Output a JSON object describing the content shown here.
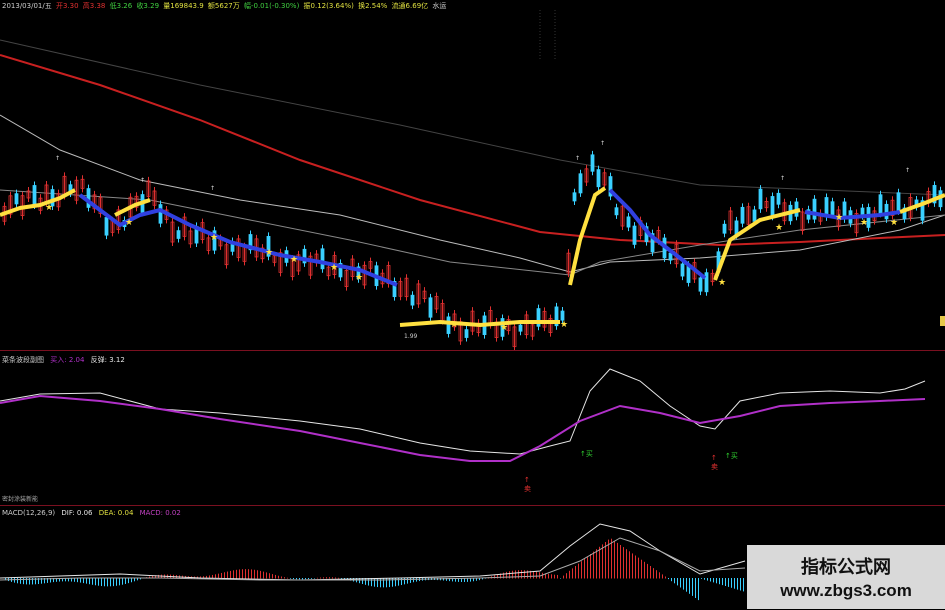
{
  "header": {
    "date": "2013/03/01/五",
    "open": "开3.30",
    "high": "高3.38",
    "low": "低3.26",
    "close": "收3.29",
    "volume": "量169843.9",
    "amount": "额5627万",
    "change": "幅-0.01(-0.30%)",
    "amplitude": "振0.12(3.64%)",
    "turnover": "换2.54%",
    "float_cap": "流通6.69亿",
    "water": "水运"
  },
  "main": {
    "low_price_label": "1.99"
  },
  "indicator": {
    "name": "菜条波段副图",
    "buy": "买入: 2.04",
    "bounce": "反弹: 3.12"
  },
  "macd": {
    "name": "MACD(12,26,9)",
    "dif": "DIF: 0.06",
    "dea": "DEA: 0.04",
    "macd": "MACD: 0.02"
  },
  "low_pane_label": "密封涂装新能",
  "signals": {
    "buy1": "买",
    "buy2": "买",
    "sell1": "卖",
    "sell2": "卖"
  },
  "watermark": {
    "cn": "指标公式网",
    "url": "www.zbgs3.com"
  },
  "colors": {
    "up": "#e03030",
    "down": "#3ad0ff",
    "ma_red": "#c82020",
    "ma_gray": "#bbbbbb",
    "ind_white": "#e6e6e6",
    "ind_purple": "#b030c8",
    "band_yellow": "#ffe040",
    "band_blue": "#3040e0"
  }
}
